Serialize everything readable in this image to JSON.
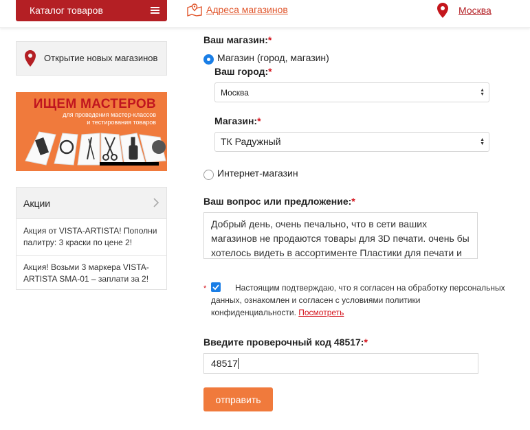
{
  "header": {
    "catalog_label": "Каталог товаров",
    "stores_link": "Адреса магазинов",
    "city": "Москва",
    "accent": "#b41f24",
    "orange": "#e0552b"
  },
  "sidebar": {
    "promo_link": "Открытие новых магазинов",
    "banner": {
      "title": "ИЩЕМ МАСТЕРОВ",
      "subtitle_line1": "для проведения мастер-классов",
      "subtitle_line2": "и тестирования товаров"
    },
    "promo": {
      "header": "Акции",
      "items": [
        "Акция от VISTA-ARTISTA! Пополни палитру: 3 краски по цене 2!",
        "Акция! Возьми 3 маркера VISTA-ARTISTA SMA-01 – заплати за 2!"
      ]
    }
  },
  "form": {
    "store_label": "Ваш магазин:",
    "required_mark": "*",
    "radio_store": "Магазин (город, магазин)",
    "city_label": "Ваш город:",
    "city_value": "Москва",
    "shop_label": "Магазин:",
    "shop_value": "ТК Радужный",
    "radio_online": "Интернет-магазин",
    "question_label": "Ваш вопрос или предложение:",
    "question_value": "Добрый день, очень печально, что в сети ваших магазинов не продаются товары для 3D печати. очень бы хотелось видеть в ассортименте Пластики для печати и",
    "consent_text": "Настоящим подтверждаю, что я согласен на обработку персональных данных, ознакомлен и согласен с условиями политики конфиденциальности.",
    "consent_link": "Посмотреть",
    "code_label": "Введите проверочный код 48517:",
    "code_value": "48517",
    "submit": "отправить",
    "checkbox_color": "#1a7ee6",
    "button_color": "#f07a3c"
  }
}
